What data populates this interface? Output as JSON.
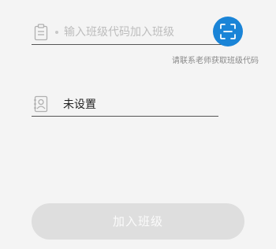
{
  "class_code": {
    "placeholder": "输入班级代码加入班级",
    "value": "",
    "icon": "clipboard-icon",
    "scan_icon": "scan-icon",
    "scan_color": "#1a84d7",
    "hint": "请联系老师获取班级代码"
  },
  "name": {
    "icon": "contact-card-icon",
    "value": "未设置"
  },
  "join_button": {
    "label": "加入班级",
    "state": "disabled"
  }
}
